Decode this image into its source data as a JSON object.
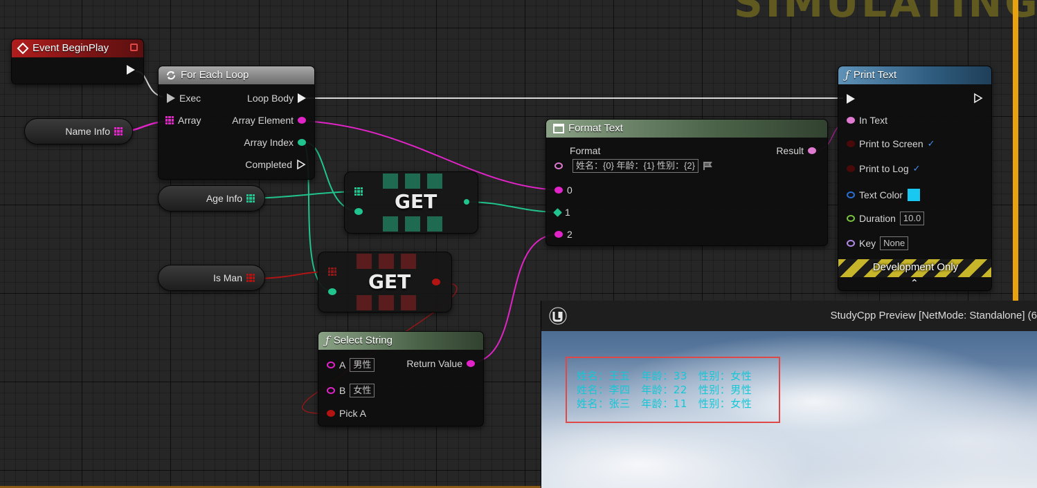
{
  "banner": {
    "text": "SIMULATING"
  },
  "event_node": {
    "title": "Event BeginPlay"
  },
  "foreach_node": {
    "title": "For Each Loop",
    "exec_label": "Exec",
    "array_label": "Array",
    "loop_body_label": "Loop Body",
    "array_element_label": "Array Element",
    "array_index_label": "Array Index",
    "completed_label": "Completed"
  },
  "variables": {
    "name_info": "Name Info",
    "age_info": "Age Info",
    "is_man": "Is Man"
  },
  "get_nodes": {
    "label": "GET"
  },
  "format_text_node": {
    "title": "Format Text",
    "format_label": "Format",
    "format_value": "姓名：{0}   年龄：{1}   性别：{2}",
    "result_label": "Result",
    "pins": [
      "0",
      "1",
      "2"
    ]
  },
  "select_string_node": {
    "title": "Select String",
    "a_label": "A",
    "a_value": "男性",
    "b_label": "B",
    "b_value": "女性",
    "pick_a_label": "Pick A",
    "return_value_label": "Return Value"
  },
  "print_text_node": {
    "title": "Print Text",
    "in_text_label": "In Text",
    "print_to_screen_label": "Print to Screen",
    "print_to_log_label": "Print to Log",
    "text_color_label": "Text Color",
    "text_color_value": "#19c8f0",
    "duration_label": "Duration",
    "duration_value": "10.0",
    "key_label": "Key",
    "key_value": "None",
    "dev_only_label": "Development Only"
  },
  "preview": {
    "title": "StudyCpp Preview [NetMode: Standalone]  (6",
    "print_lines": [
      "姓名：王五   年龄：33   性别：女性",
      "姓名：李四   年龄：22   性别：男性",
      "姓名：张三   年龄：11   性别：女性"
    ]
  },
  "colors": {
    "exec_wire": "#d9d9d9",
    "string_pin": "#e024c7",
    "int_pin": "#21c48e",
    "bool_pin": "#b21414",
    "event_header": "#b01d1d",
    "pure_header": "#4b6348",
    "function_header": "#2f5d80",
    "simulating_border": "#e8a10f"
  }
}
